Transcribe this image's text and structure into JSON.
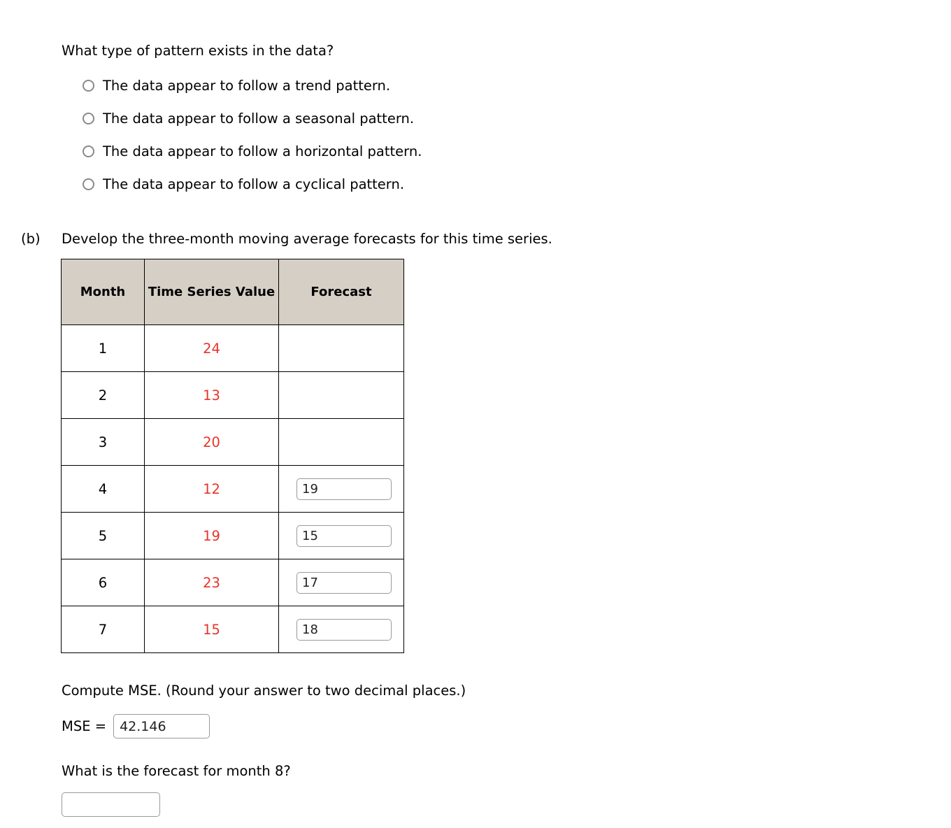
{
  "question": {
    "prompt": "What type of pattern exists in the data?",
    "options": [
      {
        "label": "The data appear to follow a trend pattern.",
        "selected": false
      },
      {
        "label": "The data appear to follow a seasonal pattern.",
        "selected": false
      },
      {
        "label": "The data appear to follow a horizontal pattern.",
        "selected": false
      },
      {
        "label": "The data appear to follow a cyclical pattern.",
        "selected": false
      }
    ]
  },
  "part_b": {
    "label": "(b)",
    "text": "Develop the three-month moving average forecasts for this time series."
  },
  "table": {
    "headers": {
      "month": "Month",
      "value": "Time Series Value",
      "forecast": "Forecast"
    },
    "rows": [
      {
        "month": "1",
        "value": "24",
        "forecast": "",
        "has_input": false
      },
      {
        "month": "2",
        "value": "13",
        "forecast": "",
        "has_input": false
      },
      {
        "month": "3",
        "value": "20",
        "forecast": "",
        "has_input": false
      },
      {
        "month": "4",
        "value": "12",
        "forecast": "19",
        "has_input": true
      },
      {
        "month": "5",
        "value": "19",
        "forecast": "15",
        "has_input": true
      },
      {
        "month": "6",
        "value": "23",
        "forecast": "17",
        "has_input": true
      },
      {
        "month": "7",
        "value": "15",
        "forecast": "18",
        "has_input": true
      }
    ],
    "header_bg": "#d5cfc5",
    "value_color": "#e8342a"
  },
  "mse": {
    "prompt": "Compute MSE. (Round your answer to two decimal places.)",
    "label": "MSE =",
    "value": "42.146"
  },
  "forecast_month8": {
    "prompt": "What is the forecast for month 8?",
    "value": ""
  },
  "chart_data": {
    "type": "table",
    "title": "Three-month moving average forecasts",
    "categories": [
      "1",
      "2",
      "3",
      "4",
      "5",
      "6",
      "7"
    ],
    "xlabel": "Month",
    "ylabel": "Time Series Value",
    "series": [
      {
        "name": "Time Series Value",
        "values": [
          24,
          13,
          20,
          12,
          19,
          23,
          15
        ]
      },
      {
        "name": "Forecast",
        "values": [
          null,
          null,
          null,
          19,
          15,
          17,
          18
        ]
      }
    ]
  }
}
